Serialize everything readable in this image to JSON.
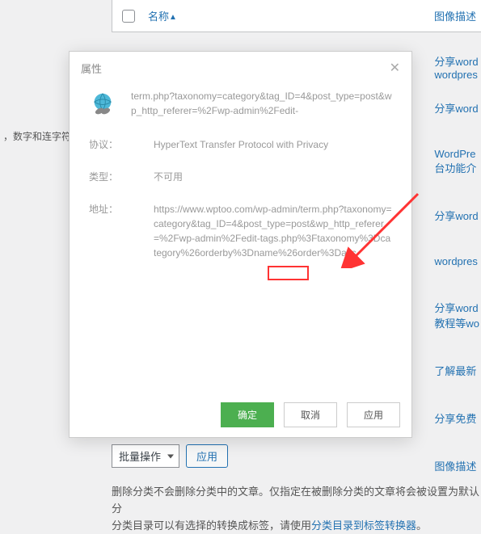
{
  "left_hint": "，数字和连字符",
  "table": {
    "name_label": "名称",
    "desc_label": "图像描述",
    "desc_label2": "图像描述"
  },
  "side_items": [
    "分享word\nwordpres",
    "分享word",
    "WordPre\n台功能介",
    "分享word",
    "wordpres",
    "分享word\n教程等wo",
    "了解最新",
    "分享免费"
  ],
  "modal": {
    "title": "属性",
    "url_preview": "term.php?taxonomy=category&tag_ID=4&post_type=post&wp_http_referer=%2Fwp-admin%2Fedit-",
    "protocol_label": "协议：",
    "protocol_value": "HyperText Transfer Protocol with Privacy",
    "type_label": "类型：",
    "type_value": "不可用",
    "address_label": "地址：",
    "address_value": "https://www.wptoo.com/wp-admin/term.php?taxonomy=category&tag_ID=4&post_type=post&wp_http_referer=%2Fwp-admin%2Fedit-tags.php%3Ftaxonomy%3Dcategory%26orderby%3Dname%26order%3Dasc",
    "ok": "确定",
    "cancel": "取消",
    "apply": "应用"
  },
  "bulk": {
    "label": "批量操作",
    "apply": "应用"
  },
  "footer": {
    "text1": "删除分类不会删除分类中的文章。仅指定在被删除分类的文章将会被设置为默认分",
    "text2": "分类目录可以有选择的转换成标签，请使用",
    "link": "分类目录到标签转换器"
  }
}
